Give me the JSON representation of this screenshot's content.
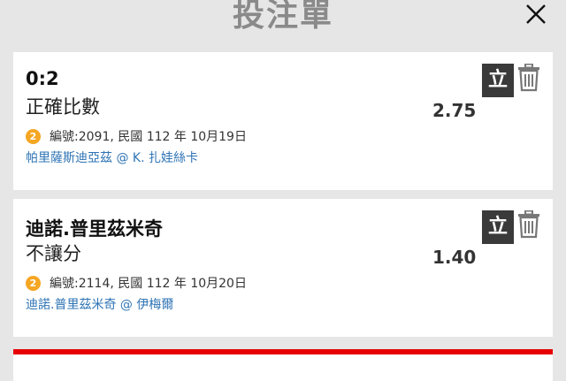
{
  "header": {
    "title": "投注單",
    "close_icon": "close-icon"
  },
  "bets": [
    {
      "selection": "0:2",
      "market": "正確比數",
      "badge": "2",
      "info": "編號:2091, 民國 112 年 10月19日",
      "teams": "帕里薩斯迪亞茲 @ K. 扎娃絲卡",
      "odds": "2.75",
      "action_label": "立"
    },
    {
      "selection": "迪諾.普里茲米奇",
      "market": "不讓分",
      "badge": "2",
      "info": "編號:2114, 民國 112 年 10月20日",
      "teams": "迪諾.普里茲米奇 @ 伊梅爾",
      "odds": "1.40",
      "action_label": "立"
    }
  ],
  "colors": {
    "accent": "#e60000",
    "link": "#2f74b5",
    "badge": "#f5a623"
  }
}
